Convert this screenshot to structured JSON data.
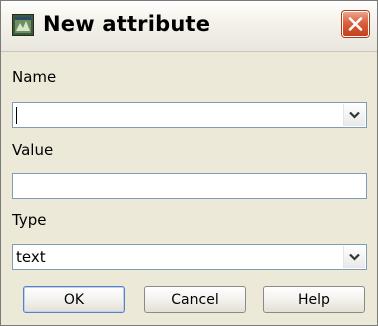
{
  "window": {
    "title": "New attribute",
    "app_icon": "application-icon",
    "close_icon": "close-icon"
  },
  "form": {
    "name": {
      "label": "Name",
      "value": ""
    },
    "value": {
      "label": "Value",
      "value": ""
    },
    "type": {
      "label": "Type",
      "value": "text"
    }
  },
  "buttons": {
    "ok": "OK",
    "cancel": "Cancel",
    "help": "Help"
  },
  "colors": {
    "close_button": "#d9613d",
    "field_border": "#7f9db9",
    "dialog_background": "#ece9d8"
  }
}
